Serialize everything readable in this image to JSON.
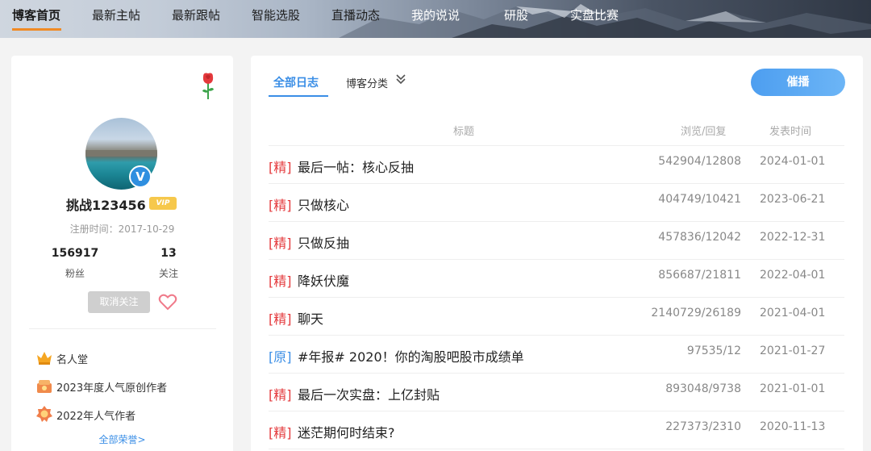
{
  "nav": {
    "items": [
      {
        "label": "博客首页"
      },
      {
        "label": "最新主帖"
      },
      {
        "label": "最新跟帖"
      },
      {
        "label": "智能选股"
      },
      {
        "label": "直播动态"
      },
      {
        "label": "我的说说"
      },
      {
        "label": "研股"
      },
      {
        "label": "实盘比赛"
      }
    ],
    "accent": "#f08a24"
  },
  "profile": {
    "username": "挑战123456",
    "vip_label": "VIP",
    "verified_mark": "V",
    "register_time": "注册时间：2017-10-29",
    "fans_count": "156917",
    "fans_label": "粉丝",
    "follow_count": "13",
    "follow_label": "关注",
    "unfollow_label": "取消关注",
    "honors": [
      {
        "label": "名人堂",
        "icon": "crown-icon"
      },
      {
        "label": "2023年度人气原创作者",
        "icon": "trophy-icon"
      },
      {
        "label": "2022年人气作者",
        "icon": "medal-icon"
      }
    ],
    "all_honors_label": "全部荣誉>"
  },
  "main": {
    "tab_all": "全部日志",
    "tab_category": "博客分类",
    "urge_button": "催播",
    "columns": {
      "title": "标题",
      "views_replies": "浏览/回复",
      "publish_time": "发表时间"
    },
    "posts": [
      {
        "tag": "[精]",
        "tag_color": "#e4393c",
        "title": "最后一帖：核心反抽",
        "stats": "542904/12808",
        "date": "2024-01-01"
      },
      {
        "tag": "[精]",
        "tag_color": "#e4393c",
        "title": "只做核心",
        "stats": "404749/10421",
        "date": "2023-06-21"
      },
      {
        "tag": "[精]",
        "tag_color": "#e4393c",
        "title": "只做反抽",
        "stats": "457836/12042",
        "date": "2022-12-31"
      },
      {
        "tag": "[精]",
        "tag_color": "#e4393c",
        "title": "降妖伏魔",
        "stats": "856687/21811",
        "date": "2022-04-01"
      },
      {
        "tag": "[精]",
        "tag_color": "#e4393c",
        "title": "聊天",
        "stats": "2140729/26189",
        "date": "2021-04-01"
      },
      {
        "tag": "[原]",
        "tag_color": "#3a8ee6",
        "title": "#年报# 2020！你的淘股吧股市成绩单",
        "stats": "97535/12",
        "date": "2021-01-27"
      },
      {
        "tag": "[精]",
        "tag_color": "#e4393c",
        "title": "最后一次实盘：上亿封贴",
        "stats": "893048/9738",
        "date": "2021-01-01"
      },
      {
        "tag": "[精]",
        "tag_color": "#e4393c",
        "title": "迷茫期何时结束?",
        "stats": "227373/2310",
        "date": "2020-11-13"
      }
    ]
  }
}
